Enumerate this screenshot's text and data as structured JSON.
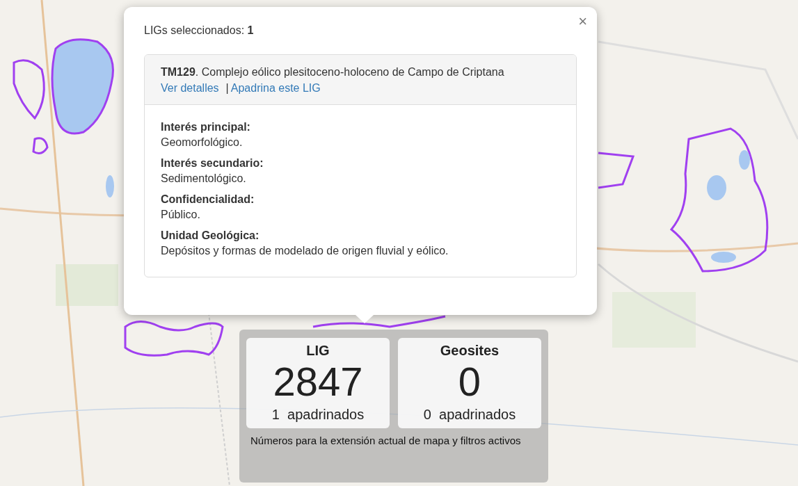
{
  "popup": {
    "heading": "LIGs seleccionados: **1**",
    "close": "×",
    "site": {
      "title": "**TM129**. Complejo eólico plesitoceno-holoceno de Campo de Criptana",
      "links": [
        "Ver detalles",
        "Apadrina este LIG"
      ],
      "separator": "|"
    },
    "fields": [
      {
        "label": "Interés principal:",
        "value": "Geomorfológico."
      },
      {
        "label": "Interés secundario:",
        "value": "Sedimentológico."
      },
      {
        "label": "Confidencialidad:",
        "value": "Público."
      },
      {
        "label": "Unidad Geológica:",
        "value": "Depósitos y formas de modelado de origen fluvial y eólico."
      }
    ]
  },
  "stats": {
    "cards": [
      {
        "title": "LIG",
        "count": "2847",
        "sponsored": "1  apadrinados"
      },
      {
        "title": "Geosites",
        "count": "0",
        "sponsored": "0  apadrinados"
      }
    ],
    "note": "Números para la extensión actual de mapa y filtros activos"
  }
}
